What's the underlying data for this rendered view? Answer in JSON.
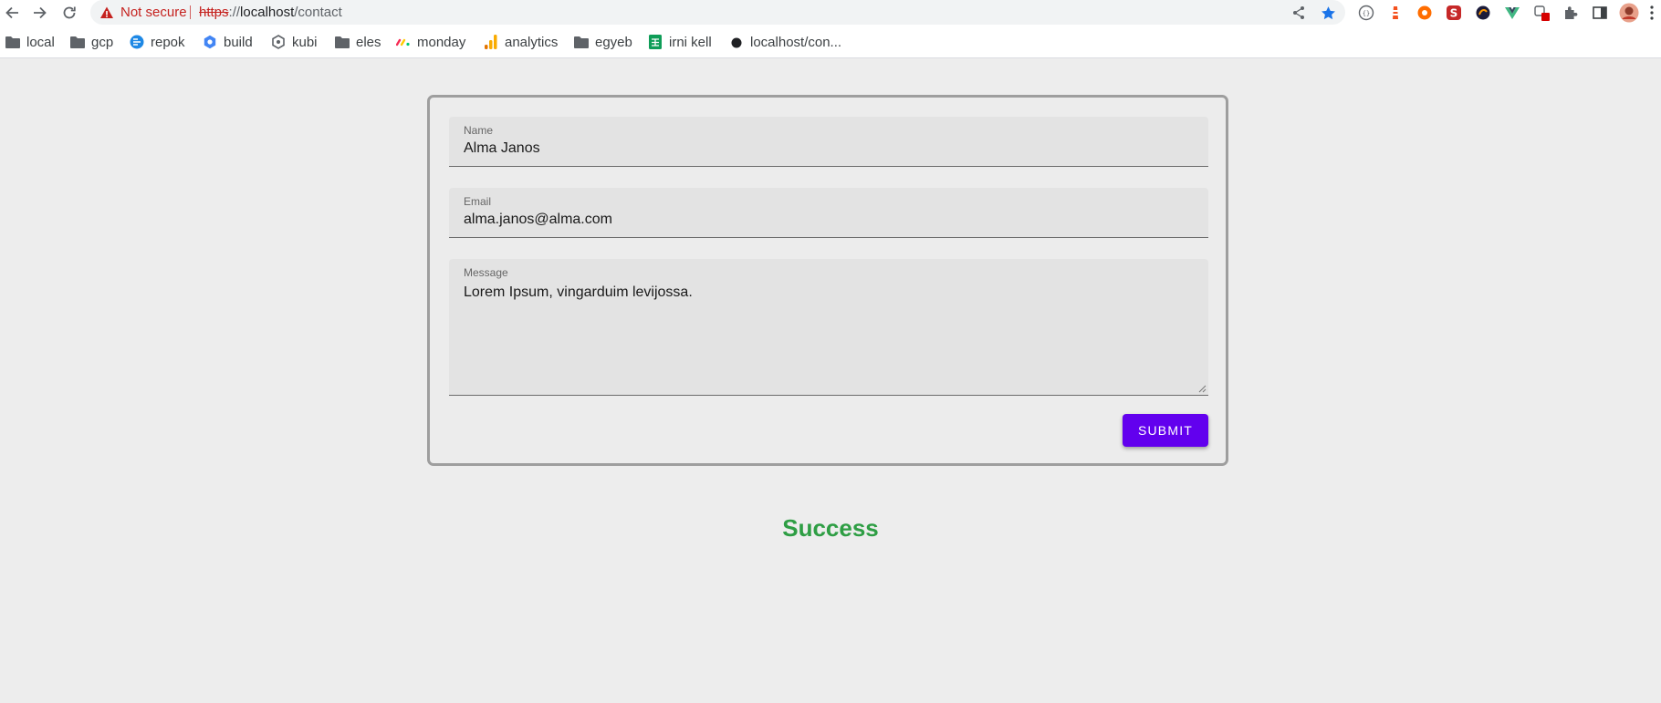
{
  "browser": {
    "security_label": "Not secure",
    "url_scheme": "https",
    "url_separator": "://",
    "url_host": "localhost",
    "url_path": "/contact",
    "bookmarks": [
      {
        "label": "local",
        "icon": "folder-icon"
      },
      {
        "label": "gcp",
        "icon": "folder-icon"
      },
      {
        "label": "repok",
        "icon": "repo-favicon-icon"
      },
      {
        "label": "build",
        "icon": "build-favicon-icon"
      },
      {
        "label": "kubi",
        "icon": "kube-favicon-icon"
      },
      {
        "label": "eles",
        "icon": "folder-icon"
      },
      {
        "label": "monday",
        "icon": "monday-favicon-icon"
      },
      {
        "label": "analytics",
        "icon": "analytics-favicon-icon"
      },
      {
        "label": "egyeb",
        "icon": "folder-icon"
      },
      {
        "label": "irni kell",
        "icon": "sheets-favicon-icon"
      },
      {
        "label": "localhost/con...",
        "icon": "page-favicon-icon"
      }
    ]
  },
  "form": {
    "name_label": "Name",
    "name_value": "Alma Janos",
    "email_label": "Email",
    "email_value": "alma.janos@alma.com",
    "message_label": "Message",
    "message_value": "Lorem Ipsum, vingarduim levijossa.",
    "submit_label": "SUBMIT"
  },
  "status": {
    "message": "Success",
    "color": "#2e9e44"
  },
  "colors": {
    "accent": "#6200ee",
    "warning": "#c5221f",
    "star": "#1a73e8"
  }
}
